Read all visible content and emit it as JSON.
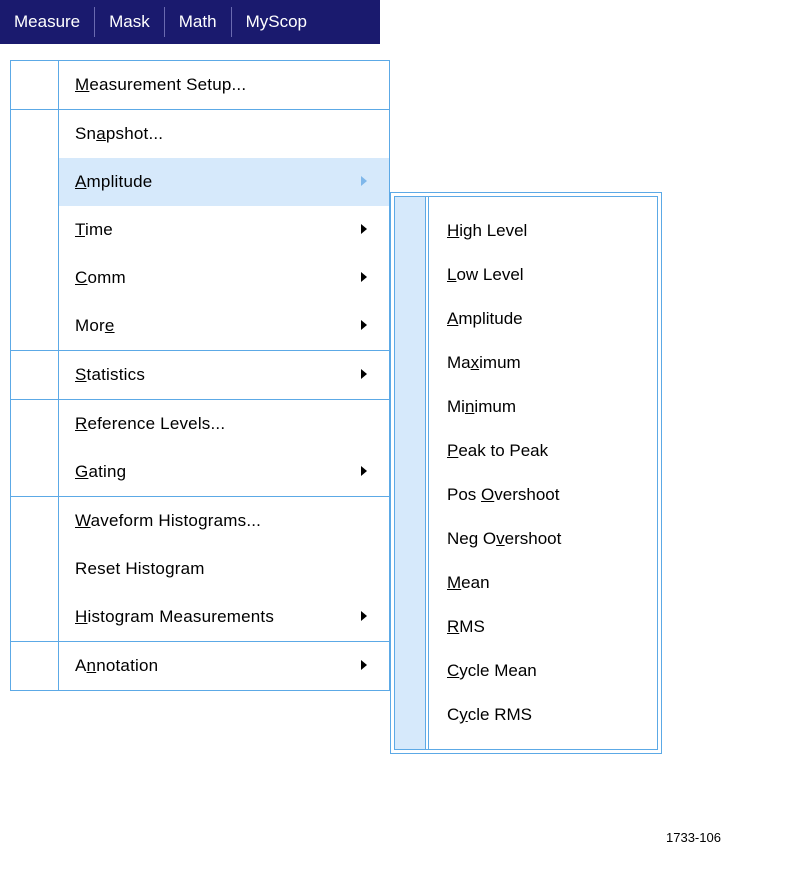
{
  "menubar": {
    "measure": "Measure",
    "mask": "Mask",
    "math": "Math",
    "myscope": "MyScop"
  },
  "menu": {
    "measurement_setup_pre": "",
    "measurement_setup_ul": "M",
    "measurement_setup_post": "easurement Setup...",
    "snapshot_pre": "Sn",
    "snapshot_ul": "a",
    "snapshot_post": "pshot...",
    "amplitude_pre": "",
    "amplitude_ul": "A",
    "amplitude_post": "mplitude",
    "time_pre": "",
    "time_ul": "T",
    "time_post": "ime",
    "comm_pre": "",
    "comm_ul": "C",
    "comm_post": "omm",
    "more_pre": "Mor",
    "more_ul": "e",
    "more_post": "",
    "statistics_pre": "",
    "statistics_ul": "S",
    "statistics_post": "tatistics",
    "reference_levels_pre": "",
    "reference_levels_ul": "R",
    "reference_levels_post": "eference Levels...",
    "gating_pre": "",
    "gating_ul": "G",
    "gating_post": "ating",
    "waveform_histograms_pre": "",
    "waveform_histograms_ul": "W",
    "waveform_histograms_post": "aveform Histograms...",
    "reset_histogram": "Reset Histogram",
    "histogram_measurements_pre": "",
    "histogram_measurements_ul": "H",
    "histogram_measurements_post": "istogram Measurements",
    "annotation_pre": "A",
    "annotation_ul": "n",
    "annotation_post": "notation"
  },
  "submenu": {
    "high_level_pre": "",
    "high_level_ul": "H",
    "high_level_post": "igh Level",
    "low_level_pre": "",
    "low_level_ul": "L",
    "low_level_post": "ow Level",
    "amplitude_pre": "",
    "amplitude_ul": "A",
    "amplitude_post": "mplitude",
    "maximum_pre": "Ma",
    "maximum_ul": "x",
    "maximum_post": "imum",
    "minimum_pre": "Mi",
    "minimum_ul": "n",
    "minimum_post": "imum",
    "peak_to_peak_pre": "",
    "peak_to_peak_ul": "P",
    "peak_to_peak_post": "eak to Peak",
    "pos_overshoot_pre": "Pos ",
    "pos_overshoot_ul": "O",
    "pos_overshoot_post": "vershoot",
    "neg_overshoot_pre": "Neg O",
    "neg_overshoot_ul": "v",
    "neg_overshoot_post": "ershoot",
    "mean_pre": "",
    "mean_ul": "M",
    "mean_post": "ean",
    "rms_pre": "",
    "rms_ul": "R",
    "rms_post": "MS",
    "cycle_mean_pre": "",
    "cycle_mean_ul": "C",
    "cycle_mean_post": "ycle Mean",
    "cycle_rms_pre": "C",
    "cycle_rms_ul": "y",
    "cycle_rms_post": "cle RMS"
  },
  "figref": "1733-106"
}
